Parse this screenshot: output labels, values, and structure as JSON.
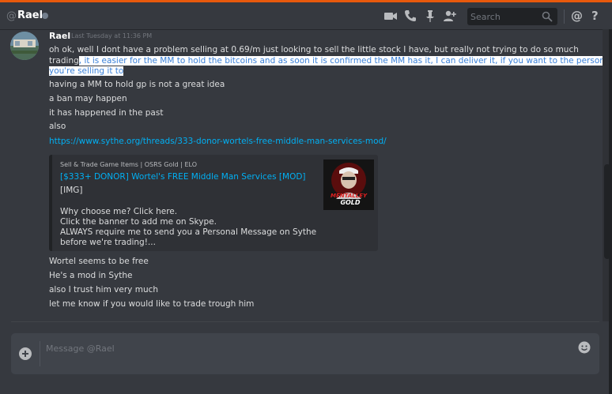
{
  "header": {
    "at": "@",
    "channel_name": "Rael",
    "search_placeholder": "Search",
    "mention_label": "@",
    "help_label": "?",
    "icons": [
      "video-call-icon",
      "voice-call-icon",
      "pin-icon",
      "add-friend-icon",
      "search-icon"
    ]
  },
  "message": {
    "author": "Rael",
    "timestamp": "Last Tuesday at 11:36 PM",
    "line1": "oh ok, well I dont have a problem selling at 0.69/m just looking to sell the little stock I have, but really not trying to do so much",
    "line2_plain": "trading",
    "line2_selected": ", it is easier for the MM to hold the bitcoins and as soon it is confirmed the MM has it, I can deliver it, if you want to the person",
    "line3_selected": "you're selling it to",
    "lines_before_link": [
      "having a MM to hold gp is not a great idea",
      "a ban may happen",
      "it has happened in the past",
      "also"
    ],
    "link": "https://www.sythe.org/threads/333-donor-wortels-free-middle-man-services-mod/",
    "lines_after_embed": [
      "Wortel seems to be free",
      "He's a mod in Sythe",
      "also I trust him very much",
      "let me know if you would like to trade trough him"
    ]
  },
  "embed": {
    "provider": "Sell & Trade Game Items | OSRS Gold | ELO",
    "title": "[$333+ DONOR] Wortel's FREE Middle Man Services [MOD]",
    "desc_img": "[IMG]",
    "desc_lines": [
      "Why choose me? Click here.",
      "Click the banner to add me on Skype.",
      "ALWAYS require me to send you a Personal Message on Sythe",
      "before we're trading!..."
    ],
    "thumb_line1": "MENTALLEY",
    "thumb_line2": "GOLD"
  },
  "composer": {
    "placeholder": "Message @Rael"
  },
  "colors": {
    "accent_top": "#e8590c",
    "link": "#00b0f4",
    "selection_text": "#3a80d8"
  }
}
